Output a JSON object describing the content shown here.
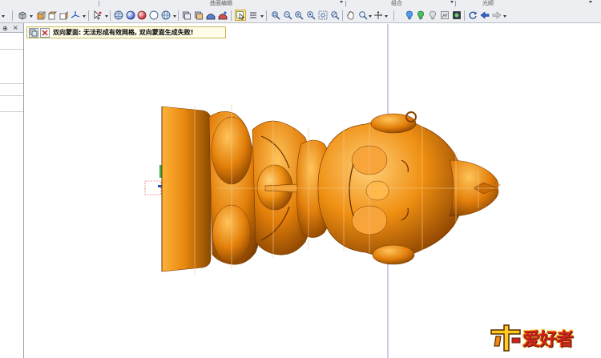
{
  "toolbar": {
    "group_titles": [
      "曲面编辑",
      "组合",
      "光顺"
    ],
    "button_icons": [
      "box-view-icon",
      "cube-front-icon",
      "cube-top-icon",
      "cube-side-icon",
      "axis-view-icon",
      "select-arrow-icon",
      "sphere-outline-icon",
      "sphere-shaded-icon",
      "sphere-red-icon",
      "sphere-blank-icon",
      "sphere-grid-icon",
      "layer-stack-icon",
      "layer-move-icon",
      "surface-shade-icon",
      "surface-select-icon",
      "list-options-icon",
      "zoom-window-icon",
      "zoom-out-icon",
      "zoom-in-icon",
      "zoom-fit-icon",
      "zoom-select-icon",
      "pan-hand-icon",
      "zoom-dynamic-icon",
      "rotate-view-icon",
      "snap-icon",
      "light-blue-icon",
      "light-green-icon",
      "light-off-icon",
      "texture-icon",
      "refresh-icon",
      "back-arrow-icon",
      "forward-arrow-icon"
    ]
  },
  "left_panel": {
    "pin_icon": "pin-icon",
    "close_icon": "close-icon"
  },
  "message": {
    "text": "双向蒙面: 无法形成有效网格, 双向蒙面生成失败!",
    "icons": [
      "copy-icon",
      "error-x-icon"
    ]
  },
  "watermark": {
    "text": "爱好者",
    "icon": "carpenter-logo-icon"
  },
  "colors": {
    "model_orange": "#e6850e",
    "guide_line": "#9f96e6",
    "error_red": "#d0201f"
  }
}
